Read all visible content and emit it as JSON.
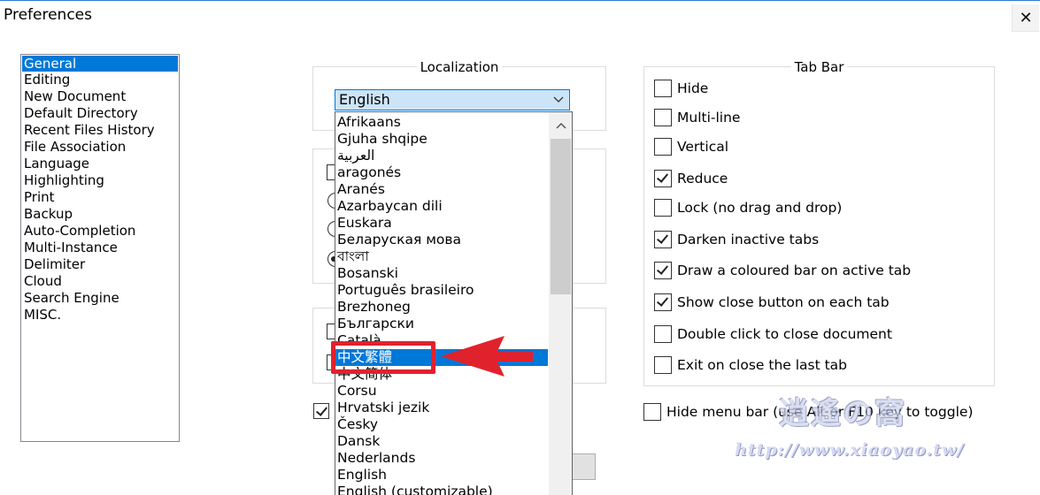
{
  "window": {
    "title": "Preferences",
    "close_glyph": "✕"
  },
  "categories": [
    "General",
    "Editing",
    "New Document",
    "Default Directory",
    "Recent Files History",
    "File Association",
    "Language",
    "Highlighting",
    "Print",
    "Backup",
    "Auto-Completion",
    "Multi-Instance",
    "Delimiter",
    "Cloud",
    "Search Engine",
    "MISC."
  ],
  "selected_category": "General",
  "localization": {
    "title": "Localization",
    "selected": "English",
    "options": [
      "Afrikaans",
      "Gjuha shqipe",
      "العربية",
      "aragonés",
      "Aranés",
      "Azarbaycan dili",
      "Euskara",
      "Беларуская мова",
      "বাংলা",
      "Bosanski",
      "Português brasileiro",
      "Brezhoneg",
      "Български",
      "Català",
      "中文繁體",
      "中文简体",
      "Corsu",
      "Hrvatski jezik",
      "Česky",
      "Dansk",
      "Nederlands",
      "English",
      "English (customizable)"
    ],
    "highlighted_option": "中文繁體"
  },
  "tab_bar": {
    "title": "Tab Bar",
    "options": [
      {
        "label": "Hide",
        "checked": false
      },
      {
        "label": "Multi-line",
        "checked": false
      },
      {
        "label": "Vertical",
        "checked": false
      },
      {
        "label": "Reduce",
        "checked": true
      },
      {
        "label": "Lock (no drag and drop)",
        "checked": false
      },
      {
        "label": "Darken inactive tabs",
        "checked": true
      },
      {
        "label": "Draw a coloured bar on active tab",
        "checked": true
      },
      {
        "label": "Show close button on each tab",
        "checked": true
      },
      {
        "label": "Double click to close document",
        "checked": false
      },
      {
        "label": "Exit on close the last tab",
        "checked": false
      }
    ]
  },
  "hide_menu_bar": {
    "label": "Hide menu bar (use Alt or F10 key to toggle)",
    "checked": false
  },
  "hidden_checkbox": {
    "checked": true
  },
  "watermark": {
    "logo": "逍遙の窩",
    "url": "http://www.xiaoyao.tw/"
  }
}
